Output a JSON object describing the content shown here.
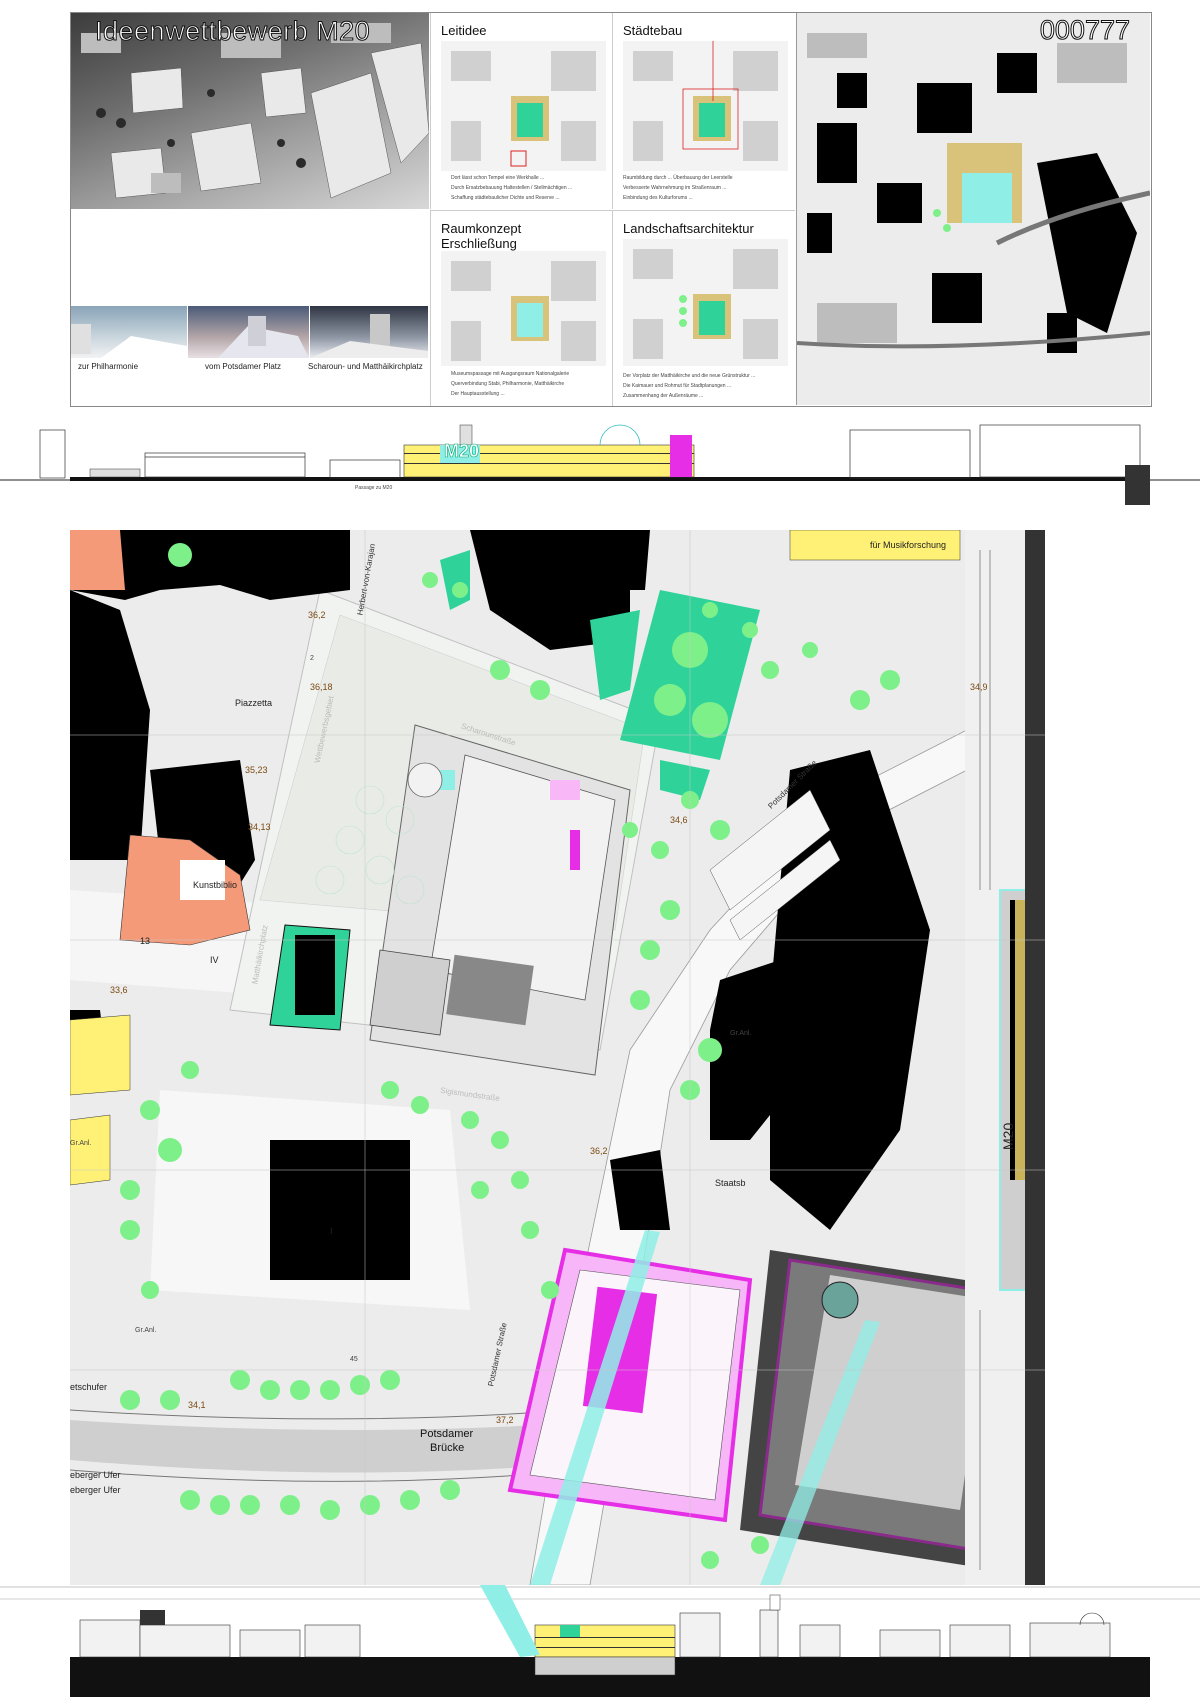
{
  "header": {
    "title": "Ideenwettbewerb M20",
    "entry_number": "000777"
  },
  "concept_panels": [
    {
      "title": "Leitidee",
      "lines": [
        "Dort lässt schon Tempel eine Werkhalle ...",
        "Durch Ersatzbebauung Haltestellen / Stellmächtigen ...",
        "Schaffung städtebaulicher Dichte und Reserve ..."
      ]
    },
    {
      "title": "Städtebau",
      "lines": [
        "Raumbildung durch ... Überbauung der Leerstelle",
        "Verbesserte Wahrnehmung im Straßenraum ...",
        "Einbindung des Kulturforums ..."
      ]
    },
    {
      "title": "Raumkonzept\nErschließung",
      "lines": [
        "Museumspassage mit Ausgangsraum Nationalgalerie",
        "Querverbindung Stabi, Philharmonie, Matthäikirche",
        "Der Hauptausstellung ..."
      ]
    },
    {
      "title": "Landschaftsarchitektur",
      "lines": [
        "Der Vorplatz der Matthäikirche und die neue Grünstruktur ...",
        "Die Kaimauer und Rohmut für Stadtplanungen ...",
        "Zusammenhang der Außenräume ..."
      ]
    }
  ],
  "views": [
    {
      "caption": "zur Philharmonie"
    },
    {
      "caption": "vom Potsdamer Platz"
    },
    {
      "caption": "Scharoun- und Matthäikirchplatz"
    }
  ],
  "section_labels": {
    "m20": "M20",
    "passage": "Passage zu M20"
  },
  "plan": {
    "labels": {
      "piazzetta": "Piazzetta",
      "kunstbibliothek": "Kunstbiblio",
      "musikforschung": "für Musikforschung",
      "staatsbibliothek": "Staatsb",
      "potsdamer_bruecke_1": "Potsdamer",
      "potsdamer_bruecke_2": "Brücke",
      "ufer_1": "eberger Ufer",
      "ufer_2": "eberger Ufer",
      "ufer_3": "etschufer",
      "gr_anl_1": "Gr.Anl.",
      "gr_anl_2": "Gr.Anl.",
      "gr_anl_3": "Gr.Anl.",
      "nr_13": "13",
      "nr_iv": "IV",
      "nr_i": "I",
      "nr_45": "45",
      "nr_2": "2"
    },
    "streets": {
      "potsdamer_strasse_1": "Potsdamer Straße",
      "potsdamer_strasse_2": "Potsdamer Straße",
      "scharoun": "Scharounstraße",
      "sigismund": "Sigismundstraße",
      "herbert_von_karajan": "Herbert-von-Karajan",
      "wettbewerbsgebiet": "Wettbewerbsgebiet",
      "matthaeikirchplatz": "Matthäikirchplatz"
    },
    "elevations": {
      "e1": "36,2",
      "e2": "36,18",
      "e3": "35,23",
      "e4": "34,13",
      "e5": "33,6",
      "e6": "34,9",
      "e7": "34,6",
      "e8": "36,2",
      "e9": "34,1",
      "e10": "37,2"
    },
    "side_label": "M20"
  },
  "colors": {
    "building_black": "#000000",
    "green_tree": "#7ef08a",
    "teal_area": "#2fd39a",
    "salmon": "#f59a78",
    "yellow": "#fff176",
    "magenta": "#e62ee6",
    "purple": "#8a2a8a",
    "cyan": "#8fefe6",
    "grey_ground": "#d9d9d9",
    "dark_grey": "#555555"
  }
}
